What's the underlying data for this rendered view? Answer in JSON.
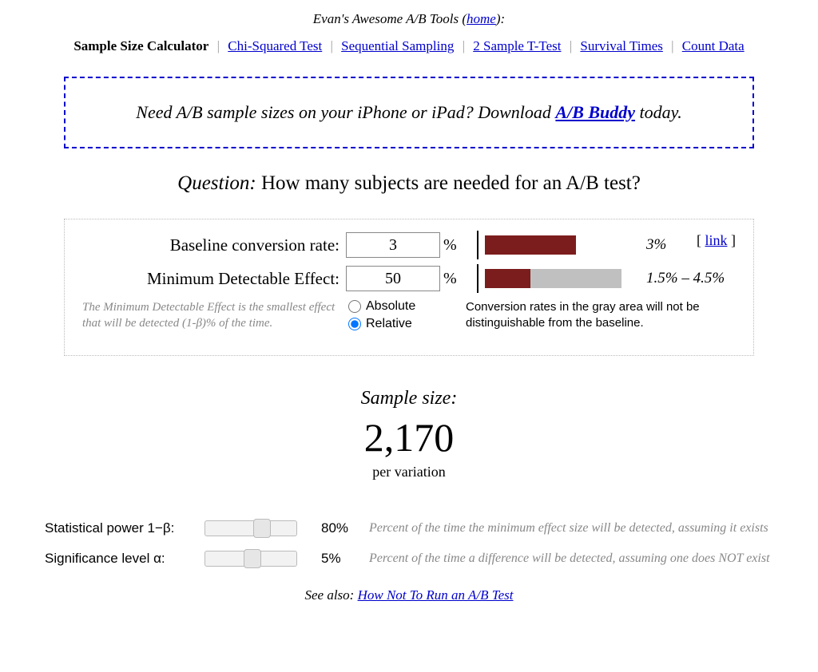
{
  "header": {
    "prefix": "Evan's Awesome A/B Tools (",
    "home_link": "home",
    "suffix": "):"
  },
  "nav": {
    "active": "Sample Size Calculator",
    "items": [
      "Chi-Squared Test",
      "Sequential Sampling",
      "2 Sample T-Test",
      "Survival Times",
      "Count Data"
    ]
  },
  "promo": {
    "before": "Need A/B sample sizes on your iPhone or iPad? Download ",
    "link": "A/B Buddy",
    "after": " today."
  },
  "question": {
    "label": "Question:",
    "text": " How many subjects are needed for an A/B test?"
  },
  "panel": {
    "baseline_label": "Baseline conversion rate:",
    "baseline_value": "3",
    "baseline_bar_label": "3%",
    "mde_label": "Minimum Detectable Effect:",
    "mde_value": "50",
    "mde_bar_label": "1.5% – 4.5%",
    "pct": "%",
    "link_text": "link",
    "link_open": "[ ",
    "link_close": " ]",
    "note_left": "The Minimum Detectable Effect is the smallest effect that will be detected (1-β)% of the time.",
    "radio_absolute": "Absolute",
    "radio_relative": "Relative",
    "note_right": "Conversion rates in the gray area will not be distinguishable from the baseline."
  },
  "result": {
    "label": "Sample size:",
    "value": "2,170",
    "per": "per variation"
  },
  "params": {
    "power_label": "Statistical power 1−β:",
    "power_value": "80%",
    "power_note": "Percent of the time the minimum effect size will be detected, assuming it exists",
    "alpha_label": "Significance level α:",
    "alpha_value": "5%",
    "alpha_note": "Percent of the time a difference will be detected, assuming one does NOT exist"
  },
  "see_also": {
    "prefix": "See also: ",
    "link": "How Not To Run an A/B Test"
  },
  "chart_data": [
    {
      "type": "bar",
      "title": "Baseline conversion rate",
      "series": [
        {
          "name": "baseline",
          "values": [
            3
          ]
        }
      ],
      "xlabel": "%",
      "ylabel": "",
      "xlim": [
        0,
        5
      ],
      "annotations": [
        "3%"
      ]
    },
    {
      "type": "bar",
      "title": "Minimum Detectable Effect range",
      "series": [
        {
          "name": "lower_detectable",
          "values": [
            1.5
          ]
        },
        {
          "name": "undetectable_gray_zone",
          "values": [
            3.0
          ]
        }
      ],
      "xlabel": "%",
      "ylabel": "",
      "xlim": [
        0,
        5
      ],
      "annotations": [
        "1.5% – 4.5%"
      ]
    }
  ]
}
